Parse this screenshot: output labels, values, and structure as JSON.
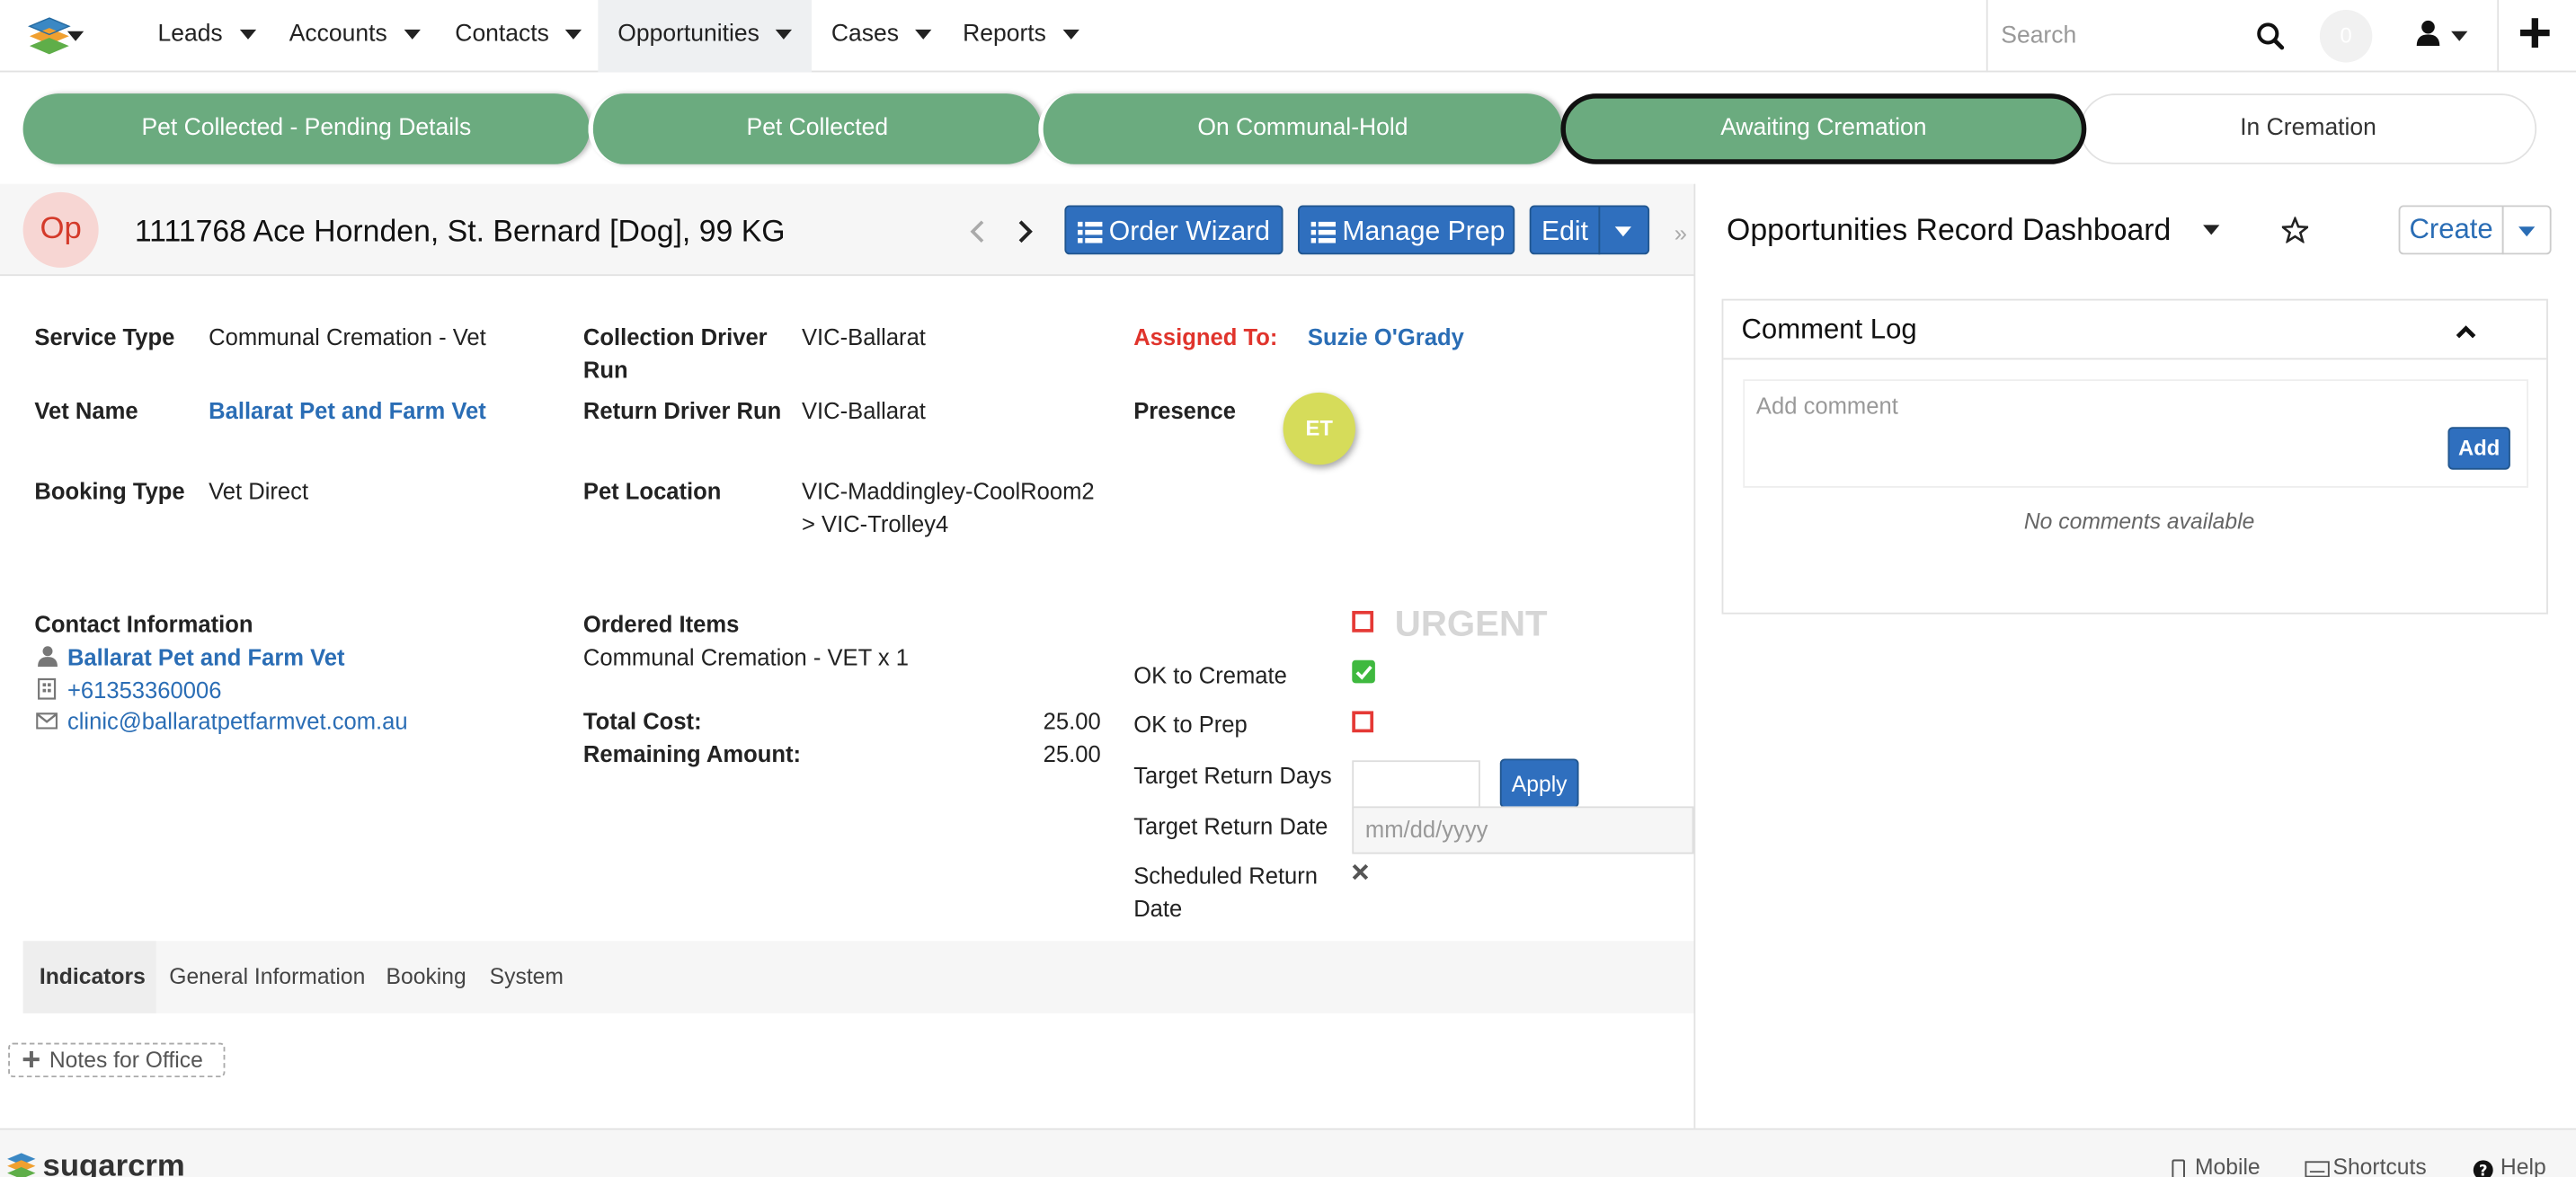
{
  "nav": {
    "items": [
      {
        "label": "Leads"
      },
      {
        "label": "Accounts"
      },
      {
        "label": "Contacts"
      },
      {
        "label": "Opportunities"
      },
      {
        "label": "Cases"
      },
      {
        "label": "Reports"
      }
    ],
    "search_placeholder": "Search",
    "notification_count": "0"
  },
  "stages": [
    {
      "label": "Pet Collected - Pending Details"
    },
    {
      "label": "Pet Collected"
    },
    {
      "label": "On Communal-Hold"
    },
    {
      "label": "Awaiting Cremation"
    },
    {
      "label": "In Cremation"
    }
  ],
  "record": {
    "module_badge": "Op",
    "title": "1111768 Ace Hornden, St. Bernard [Dog], 99 KG",
    "order_wizard": "Order Wizard",
    "manage_prep": "Manage Prep",
    "edit": "Edit"
  },
  "fields": {
    "service_type_label": "Service Type",
    "service_type": "Communal Cremation - Vet",
    "vet_name_label": "Vet Name",
    "vet_name": "Ballarat Pet and Farm Vet",
    "booking_type_label": "Booking Type",
    "booking_type": "Vet Direct",
    "collection_driver_label_1": "Collection Driver",
    "collection_driver_label_2": "Run",
    "collection_driver": "VIC-Ballarat",
    "return_driver_label": "Return Driver Run",
    "return_driver": "VIC-Ballarat",
    "pet_location_label": "Pet Location",
    "pet_location_1": "VIC-Maddingley-CoolRoom2",
    "pet_location_2": "> VIC-Trolley4",
    "assigned_to_label": "Assigned To:",
    "assigned_to": "Suzie O'Grady",
    "presence_label": "Presence",
    "presence_initials": "ET"
  },
  "contact": {
    "heading": "Contact Information",
    "name": "Ballarat Pet and Farm Vet",
    "phone": "+61353360006",
    "email": "clinic@ballaratpetfarmvet.com.au"
  },
  "order": {
    "heading": "Ordered Items",
    "item": "Communal Cremation - VET x 1",
    "total_label": "Total Cost:",
    "total": "25.00",
    "remaining_label": "Remaining Amount:",
    "remaining": "25.00"
  },
  "flags": {
    "urgent": "URGENT",
    "urgent_checked": false,
    "ok_cremate_label": "OK to Cremate",
    "ok_cremate_checked": true,
    "ok_prep_label": "OK to Prep",
    "ok_prep_checked": false,
    "target_days_label": "Target Return Days",
    "target_days_value": "",
    "apply": "Apply",
    "target_date_label": "Target Return Date",
    "target_date_placeholder": "mm/dd/yyyy",
    "scheduled_label_1": "Scheduled Return",
    "scheduled_label_2": "Date"
  },
  "tabs": [
    {
      "label": "Indicators"
    },
    {
      "label": "General Information"
    },
    {
      "label": "Booking"
    },
    {
      "label": "System"
    }
  ],
  "notes_button": "Notes for Office",
  "dashboard": {
    "title": "Opportunities Record Dashboard",
    "create": "Create",
    "comment_log_title": "Comment Log",
    "comment_placeholder": "Add comment",
    "add": "Add",
    "no_comments": "No comments available"
  },
  "footer": {
    "logo_text": "sugarcrm",
    "mobile": "Mobile",
    "shortcuts": "Shortcuts",
    "help": "Help"
  },
  "colors": {
    "stage_green": "#6bab7f",
    "primary_blue": "#2f6fbe",
    "link_blue": "#2a6db5",
    "assigned_red": "#e0342c",
    "check_red": "#e53935",
    "check_green": "#3fb93f",
    "presence_yellow": "#d6dc5a"
  }
}
